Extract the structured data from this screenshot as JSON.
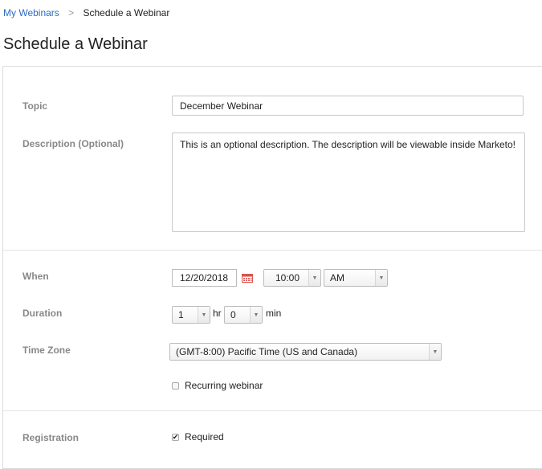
{
  "breadcrumb": {
    "parent": "My Webinars",
    "separator": ">",
    "current": "Schedule a Webinar"
  },
  "page": {
    "title": "Schedule a Webinar"
  },
  "form": {
    "topic": {
      "label": "Topic",
      "value": "December Webinar"
    },
    "description": {
      "label": "Description (Optional)",
      "value": "This is an optional description. The description will be viewable inside Marketo!"
    },
    "when": {
      "label": "When",
      "date": "12/20/2018",
      "time": "10:00",
      "ampm": "AM",
      "calendar_icon": "calendar-icon"
    },
    "duration": {
      "label": "Duration",
      "hours": "1",
      "hours_unit": "hr",
      "minutes": "0",
      "minutes_unit": "min"
    },
    "timezone": {
      "label": "Time Zone",
      "value": "(GMT-8:00) Pacific Time (US and Canada)"
    },
    "recurring": {
      "label": "Recurring webinar",
      "checked": false
    },
    "registration": {
      "label": "Registration",
      "option_label": "Required",
      "checked": true
    }
  },
  "colors": {
    "link": "#2d6cc0",
    "label": "#888888",
    "border": "#c8c8c8",
    "calendar_icon": "#d9534f"
  }
}
